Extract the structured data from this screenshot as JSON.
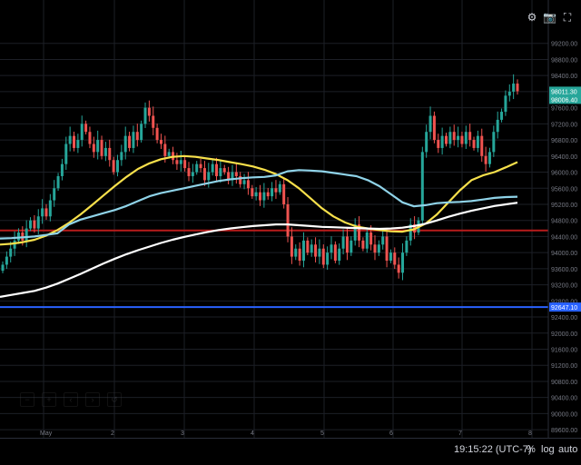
{
  "toolbar": {
    "icons": [
      "settings-icon",
      "camera-icon",
      "fullscreen-icon"
    ]
  },
  "status": {
    "time": "19:15:22 (UTC-7)",
    "percent_label": "%",
    "log_label": "log",
    "auto_label": "auto"
  },
  "colors": {
    "background": "#000000",
    "grid": "#1c1f26",
    "up": "#26a69a",
    "down": "#ef5350",
    "ma_yellow": "#f7e04b",
    "ma_cyan": "#8fd3e8",
    "ma_white": "#ffffff",
    "line_red": "#b71c1c",
    "line_blue": "#2962ff"
  },
  "chart_data": {
    "type": "candlestick",
    "title": "",
    "xlabel": "",
    "ylabel": "",
    "x_ticks": [
      "May",
      "2",
      "3",
      "4",
      "5",
      "6",
      "7",
      "8"
    ],
    "y_ticks": [
      99200,
      98800,
      98400,
      98000,
      97600,
      97200,
      96800,
      96400,
      96000,
      95600,
      95200,
      94800,
      94400,
      94000,
      93600,
      93200,
      92800,
      92400,
      92000,
      91600,
      91200,
      90800,
      90400,
      90000,
      89600
    ],
    "ylim": [
      89400,
      99600
    ],
    "price_labels": [
      {
        "text": "98011.30",
        "value": 98011.3,
        "color": "#26a69a"
      },
      {
        "text": "98006.40",
        "value": 98006.4,
        "color": "#26a69a"
      },
      {
        "text": "92647.10",
        "value": 92647.1,
        "color": "#2962ff"
      }
    ],
    "horizontal_lines": [
      {
        "value": 94550,
        "color": "#b71c1c"
      },
      {
        "value": 92647.1,
        "color": "#2962ff"
      }
    ],
    "series": [
      {
        "kind": "close",
        "values": [
          93700,
          93900,
          94100,
          94300,
          94500,
          94300,
          94600,
          94800,
          94600,
          94900,
          95100,
          94900,
          95300,
          95600,
          95900,
          96200,
          96700,
          96900,
          96600,
          96800,
          97200,
          97000,
          96700,
          96500,
          96800,
          96400,
          96600,
          96300,
          96000,
          96300,
          96500,
          96900,
          96600,
          97000,
          96800,
          97200,
          97600,
          97400,
          97100,
          96800,
          96700,
          96400,
          96500,
          96300,
          96200,
          96300,
          96100,
          95900,
          96000,
          96200,
          96100,
          95800,
          96000,
          96200,
          95900,
          96100,
          96000,
          95800,
          96000,
          95900,
          95700,
          95800,
          95600,
          95400,
          95500,
          95300,
          95500,
          95400,
          95600,
          95500,
          95700,
          95200,
          94400,
          93900,
          94100,
          93800,
          94300,
          94000,
          94200,
          93900,
          94100,
          93700,
          94000,
          94200,
          93800,
          94100,
          94400,
          94000,
          94300,
          94700,
          94300,
          94100,
          94500,
          94200,
          94000,
          94200,
          94400,
          93800,
          94000,
          93700,
          93500,
          94000,
          94300,
          94700,
          94500,
          94800,
          96500,
          97000,
          97400,
          96800,
          96600,
          96900,
          96700,
          97000,
          96800,
          96900,
          96700,
          97000,
          96800,
          96600,
          96900,
          96400,
          96200,
          96500,
          97000,
          97300,
          97500,
          97900,
          98000,
          98200,
          98011.3
        ]
      },
      {
        "kind": "moving-average",
        "color": "#f7e04b",
        "values": [
          94200,
          94220,
          94260,
          94320,
          94420,
          94560,
          94740,
          94950,
          95180,
          95420,
          95660,
          95880,
          96080,
          96220,
          96320,
          96380,
          96400,
          96380,
          96340,
          96300,
          96250,
          96200,
          96140,
          96060,
          95950,
          95800,
          95600,
          95350,
          95100,
          94900,
          94750,
          94650,
          94600,
          94560,
          94530,
          94520,
          94580,
          94720,
          94950,
          95250,
          95550,
          95800,
          95920,
          96000,
          96120,
          96250
        ]
      },
      {
        "kind": "moving-average",
        "color": "#8fd3e8",
        "values": [
          94350,
          94360,
          94380,
          94400,
          94440,
          94480,
          94700,
          94820,
          94900,
          94980,
          95060,
          95160,
          95280,
          95400,
          95480,
          95540,
          95600,
          95660,
          95720,
          95780,
          95820,
          95850,
          95870,
          95880,
          95920,
          96020,
          96050,
          96040,
          96020,
          95980,
          95940,
          95900,
          95800,
          95650,
          95450,
          95250,
          95150,
          95180,
          95230,
          95250,
          95260,
          95280,
          95320,
          95360,
          95380,
          95390
        ]
      },
      {
        "kind": "moving-average",
        "color": "#ffffff",
        "values": [
          92900,
          92950,
          93000,
          93050,
          93130,
          93230,
          93350,
          93470,
          93600,
          93730,
          93850,
          93960,
          94060,
          94150,
          94240,
          94320,
          94390,
          94450,
          94510,
          94560,
          94600,
          94630,
          94660,
          94680,
          94700,
          94700,
          94680,
          94660,
          94640,
          94630,
          94620,
          94610,
          94600,
          94590,
          94600,
          94620,
          94660,
          94720,
          94800,
          94890,
          94970,
          95040,
          95100,
          95160,
          95200,
          95240
        ]
      }
    ]
  }
}
